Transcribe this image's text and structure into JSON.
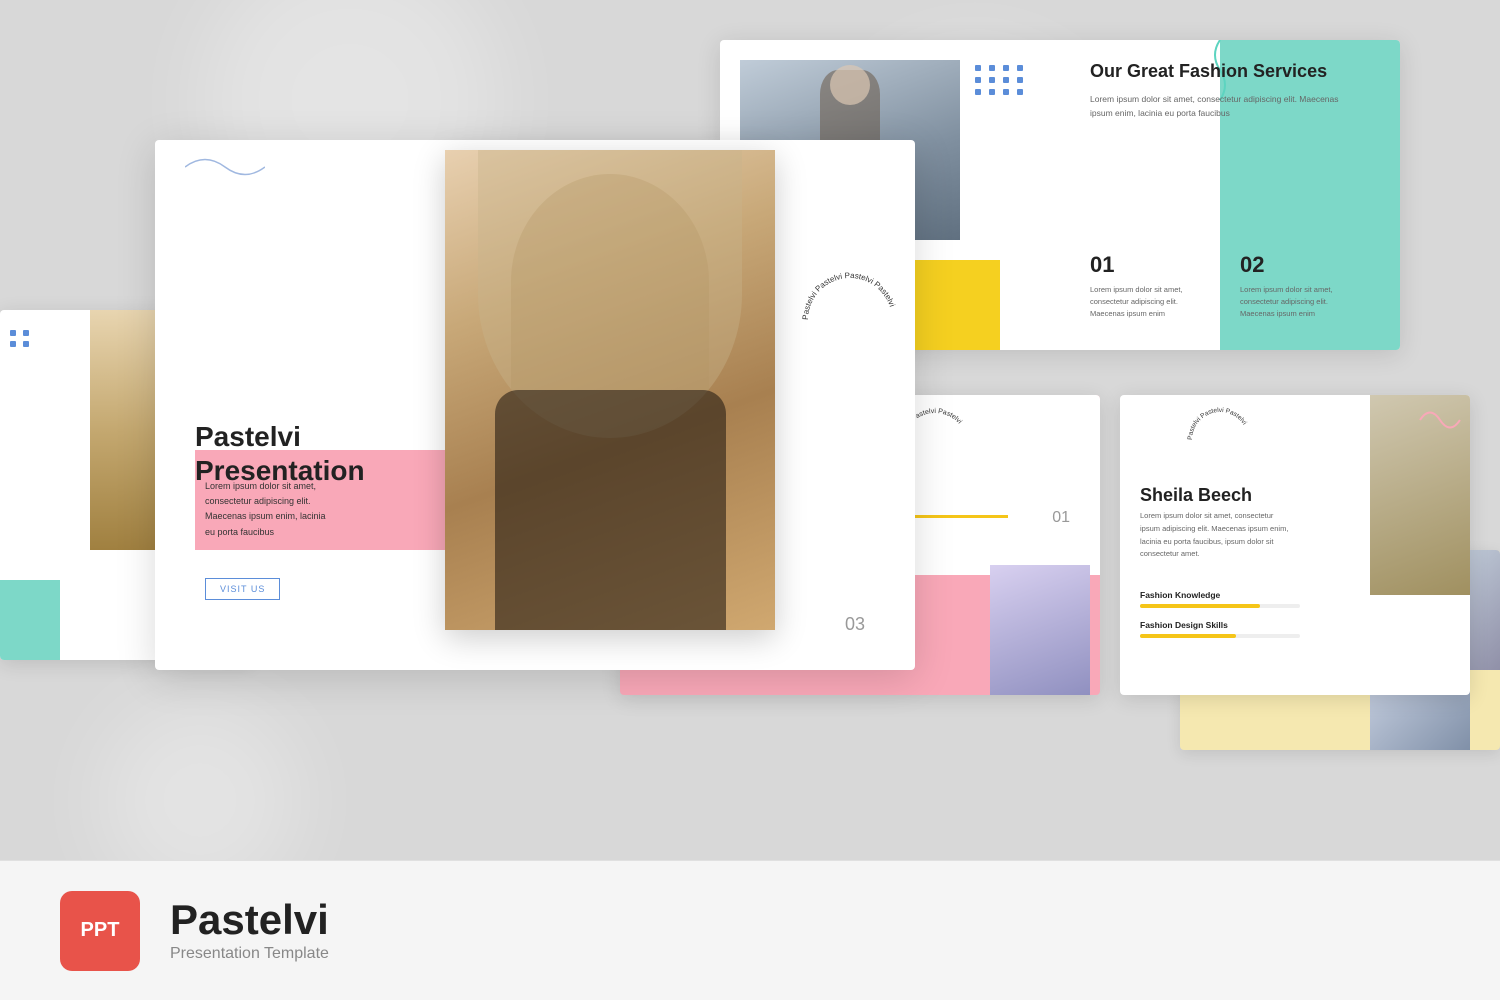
{
  "background": {
    "color": "#d8d8d8"
  },
  "slides": {
    "main": {
      "title_line1": "Pastelvi",
      "title_line2": "Presentation",
      "lorem": "Lorem ipsum dolor sit amet,\nconsectetur adipiscing elit.\nMaecenas ipsum enim, lacinia\neu porta faucibus",
      "visit_label": "VISIT US",
      "slide_number": "03",
      "circular_text": "Pastelvi  Pastelvi  Pastelvi  "
    },
    "top_right": {
      "title": "Our Great Fashion Services",
      "description": "Lorem ipsum dolor sit amet, consectetur adipiscing elit.\nMaecenas ipsum enim, lacinia  eu porta faucibus",
      "num1": "01",
      "num1_text": "Lorem ipsum dolor sit amet,\nconsectetur adipiscing elit.\nMaecenas ipsum enim",
      "num2": "02",
      "num2_text": "Lorem ipsum dolor sit amet,\nconsectetur adipiscing elit.\nMaecenas ipsum enim"
    },
    "bottom_center": {
      "slide_number": "01",
      "circular_text": "Pastelvi  Pastelvi  Pastelvi  "
    },
    "bottom_right": {
      "name": "Sheila Beech",
      "description": "Lorem ipsum dolor sit amet, consectetur\nipsum adipiscing elit. Maecenas ipsum enim,\nlacinia  eu porta faucibus, ipsum dolor sit\nconsectetur  amet.",
      "skill1_label": "Fashion Knowledge",
      "skill1_pct": 75,
      "skill2_label": "Fashion Design Skills",
      "skill2_pct": 60,
      "circular_text": "Pastelvi  Pastelvi  "
    }
  },
  "bottom_bar": {
    "ppt_label": "PPT",
    "brand_name": "Pastelvi",
    "subtitle": "Presentation Template"
  }
}
